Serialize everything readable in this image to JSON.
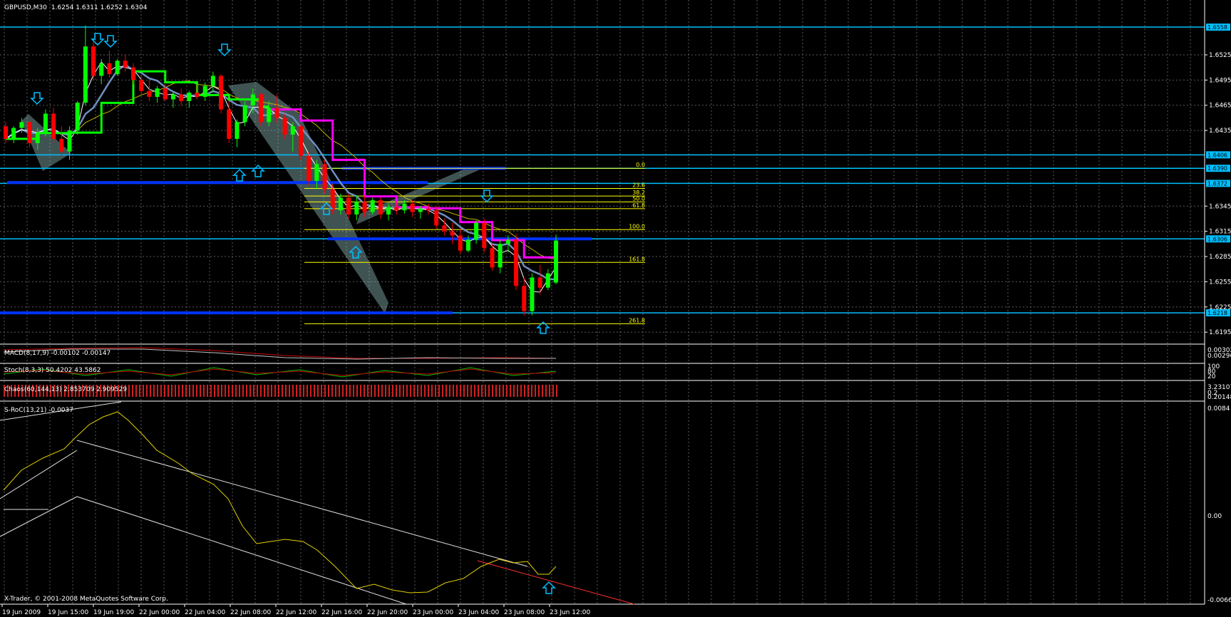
{
  "header": {
    "symbol": "GBPUSD,M30",
    "ohlc": "1.6254 1.6311 1.6252 1.6304"
  },
  "copyright": "X-Trader, © 2001-2008 MetaQuotes Software Corp.",
  "colors": {
    "background": "#000000",
    "grid": "#5a5a5a",
    "bull": "#00ff00",
    "bear": "#ff0000",
    "hline": "#00bfff",
    "pivot_line": "#0033ff",
    "fib": "#ffff00",
    "ma_magenta": "#ff00ff",
    "ma_lime": "#00ff00",
    "ma_steel": "#6f8fc0",
    "arrow": "#00bfff",
    "channel": "#ffffff"
  },
  "chart_data": {
    "type": "candlestick",
    "price_axis_labels": [
      "1.6525",
      "1.6495",
      "1.6465",
      "1.6435",
      "1.6345",
      "1.6315",
      "1.6285",
      "1.6255",
      "1.6225",
      "1.6195"
    ],
    "price_box_labels": [
      "1.6558",
      "1.6406",
      "1.6390",
      "1.6372",
      "1.6306",
      "1.6218"
    ],
    "ylim": [
      1.6185,
      1.6575
    ],
    "time_labels": [
      "19 Jun 2009",
      "19 Jun 15:00",
      "19 Jun 19:00",
      "22 Jun 00:00",
      "22 Jun 04:00",
      "22 Jun 08:00",
      "22 Jun 12:00",
      "22 Jun 16:00",
      "22 Jun 20:00",
      "23 Jun 00:00",
      "23 Jun 04:00",
      "23 Jun 08:00",
      "23 Jun 12:00"
    ],
    "horizontal_lines": [
      1.6558,
      1.6406,
      1.639,
      1.6372,
      1.6306,
      1.6218
    ],
    "fibonacci": {
      "levels": [
        "0.0",
        "23.6",
        "38.2",
        "50.0",
        "61.8",
        "100.0",
        "161.8",
        "261.8"
      ],
      "prices": [
        1.639,
        1.6366,
        1.6357,
        1.635,
        1.6342,
        1.6317,
        1.6278,
        1.6205
      ]
    },
    "candles": [
      [
        1.644,
        1.6445,
        1.642,
        1.6425
      ],
      [
        1.6425,
        1.644,
        1.642,
        1.6438
      ],
      [
        1.6438,
        1.645,
        1.6432,
        1.6445
      ],
      [
        1.6445,
        1.6448,
        1.6415,
        1.642
      ],
      [
        1.642,
        1.6438,
        1.6412,
        1.6432
      ],
      [
        1.6432,
        1.646,
        1.6428,
        1.6455
      ],
      [
        1.6455,
        1.6462,
        1.642,
        1.6425
      ],
      [
        1.6425,
        1.644,
        1.6405,
        1.641
      ],
      [
        1.641,
        1.644,
        1.64,
        1.6435
      ],
      [
        1.6435,
        1.647,
        1.643,
        1.6468
      ],
      [
        1.6468,
        1.656,
        1.6465,
        1.6535
      ],
      [
        1.6535,
        1.6545,
        1.6495,
        1.65
      ],
      [
        1.65,
        1.652,
        1.649,
        1.6515
      ],
      [
        1.6515,
        1.653,
        1.6498,
        1.6502
      ],
      [
        1.6502,
        1.652,
        1.65,
        1.6518
      ],
      [
        1.6518,
        1.6525,
        1.6505,
        1.651
      ],
      [
        1.651,
        1.6515,
        1.649,
        1.6495
      ],
      [
        1.6495,
        1.65,
        1.6478,
        1.6482
      ],
      [
        1.6482,
        1.6495,
        1.647,
        1.6475
      ],
      [
        1.6475,
        1.6488,
        1.6468,
        1.6485
      ],
      [
        1.6485,
        1.649,
        1.647,
        1.6472
      ],
      [
        1.6472,
        1.648,
        1.6462,
        1.6478
      ],
      [
        1.6478,
        1.6485,
        1.6465,
        1.647
      ],
      [
        1.647,
        1.6482,
        1.6462,
        1.648
      ],
      [
        1.648,
        1.649,
        1.6472,
        1.6475
      ],
      [
        1.6475,
        1.6492,
        1.647,
        1.6488
      ],
      [
        1.6488,
        1.6505,
        1.648,
        1.65
      ],
      [
        1.65,
        1.6502,
        1.6455,
        1.646
      ],
      [
        1.646,
        1.647,
        1.642,
        1.6425
      ],
      [
        1.6425,
        1.6448,
        1.6415,
        1.6445
      ],
      [
        1.6445,
        1.647,
        1.644,
        1.6465
      ],
      [
        1.6465,
        1.6485,
        1.6455,
        1.6478
      ],
      [
        1.6478,
        1.648,
        1.644,
        1.6445
      ],
      [
        1.6445,
        1.647,
        1.644,
        1.6462
      ],
      [
        1.6462,
        1.6478,
        1.6445,
        1.645
      ],
      [
        1.645,
        1.6455,
        1.6425,
        1.643
      ],
      [
        1.643,
        1.6445,
        1.641,
        1.644
      ],
      [
        1.644,
        1.6442,
        1.64,
        1.6405
      ],
      [
        1.6405,
        1.641,
        1.637,
        1.6375
      ],
      [
        1.6375,
        1.64,
        1.6365,
        1.6395
      ],
      [
        1.6395,
        1.64,
        1.636,
        1.6365
      ],
      [
        1.6365,
        1.6372,
        1.6335,
        1.634
      ],
      [
        1.634,
        1.636,
        1.6335,
        1.6355
      ],
      [
        1.6355,
        1.636,
        1.633,
        1.6335
      ],
      [
        1.6335,
        1.6358,
        1.6328,
        1.635
      ],
      [
        1.635,
        1.6358,
        1.6332,
        1.6338
      ],
      [
        1.6338,
        1.6355,
        1.6335,
        1.6352
      ],
      [
        1.6352,
        1.6355,
        1.633,
        1.6335
      ],
      [
        1.6335,
        1.6348,
        1.6328,
        1.6344
      ],
      [
        1.6344,
        1.635,
        1.6335,
        1.634
      ],
      [
        1.634,
        1.6352,
        1.6336,
        1.6348
      ],
      [
        1.6348,
        1.6352,
        1.6332,
        1.6338
      ],
      [
        1.6338,
        1.6345,
        1.633,
        1.6342
      ],
      [
        1.6342,
        1.6348,
        1.6335,
        1.634
      ],
      [
        1.634,
        1.6345,
        1.6318,
        1.6322
      ],
      [
        1.6322,
        1.633,
        1.631,
        1.6315
      ],
      [
        1.6315,
        1.6325,
        1.63,
        1.631
      ],
      [
        1.631,
        1.6318,
        1.6288,
        1.6292
      ],
      [
        1.6292,
        1.631,
        1.629,
        1.6305
      ],
      [
        1.6305,
        1.6328,
        1.63,
        1.6325
      ],
      [
        1.6325,
        1.633,
        1.629,
        1.6295
      ],
      [
        1.6295,
        1.63,
        1.6268,
        1.6272
      ],
      [
        1.6272,
        1.6305,
        1.6265,
        1.63
      ],
      [
        1.63,
        1.631,
        1.629,
        1.6305
      ],
      [
        1.6305,
        1.6312,
        1.6245,
        1.625
      ],
      [
        1.625,
        1.626,
        1.6215,
        1.622
      ],
      [
        1.622,
        1.6265,
        1.6215,
        1.626
      ],
      [
        1.626,
        1.6275,
        1.624,
        1.6248
      ],
      [
        1.6248,
        1.627,
        1.6245,
        1.6265
      ],
      [
        1.6254,
        1.6311,
        1.6252,
        1.6304
      ]
    ]
  },
  "indicators": {
    "macd": "MACD(8,17,9) -0.00102 -0.00147",
    "macd_scale": [
      "0.00302",
      "0.00296"
    ],
    "stoch": "Stoch(8,3,3) 50.4202 43.5862",
    "stoch_scale": [
      "100",
      "80",
      "20",
      "0"
    ],
    "chaos": "Chaos(60,144,13) 2.853709 2.909529",
    "chaos_scale": [
      "3.23107",
      "0.2",
      "0.20148"
    ],
    "sroc": "S-RoC(13,21) -0.0037",
    "sroc_scale": [
      "0.0084",
      "0.00",
      "-0.0066"
    ]
  }
}
